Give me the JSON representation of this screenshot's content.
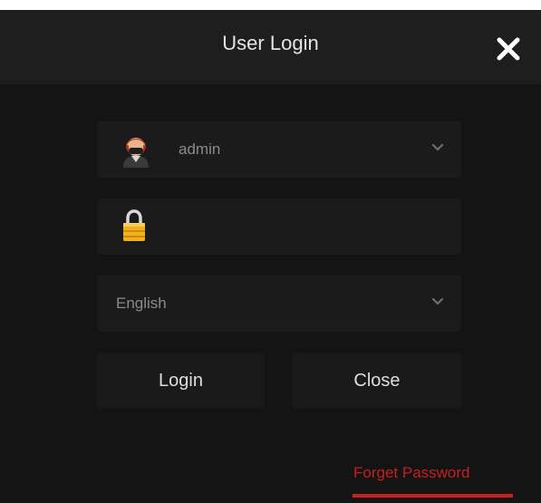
{
  "dialog": {
    "title": "User Login",
    "close_icon": "close-icon",
    "colors": {
      "background": "#141414",
      "titlebar": "#1e1e1e",
      "field": "#1b1b1b",
      "accent": "#c81f1f"
    }
  },
  "user_select": {
    "icon": "user-avatar-icon",
    "value": "admin",
    "dropdown_icon": "chevron-down-icon"
  },
  "password": {
    "icon": "lock-icon",
    "value": ""
  },
  "language_select": {
    "value": "English",
    "dropdown_icon": "chevron-down-icon"
  },
  "buttons": {
    "login_label": "Login",
    "close_label": "Close"
  },
  "links": {
    "forgot_password": "Forget Password"
  }
}
